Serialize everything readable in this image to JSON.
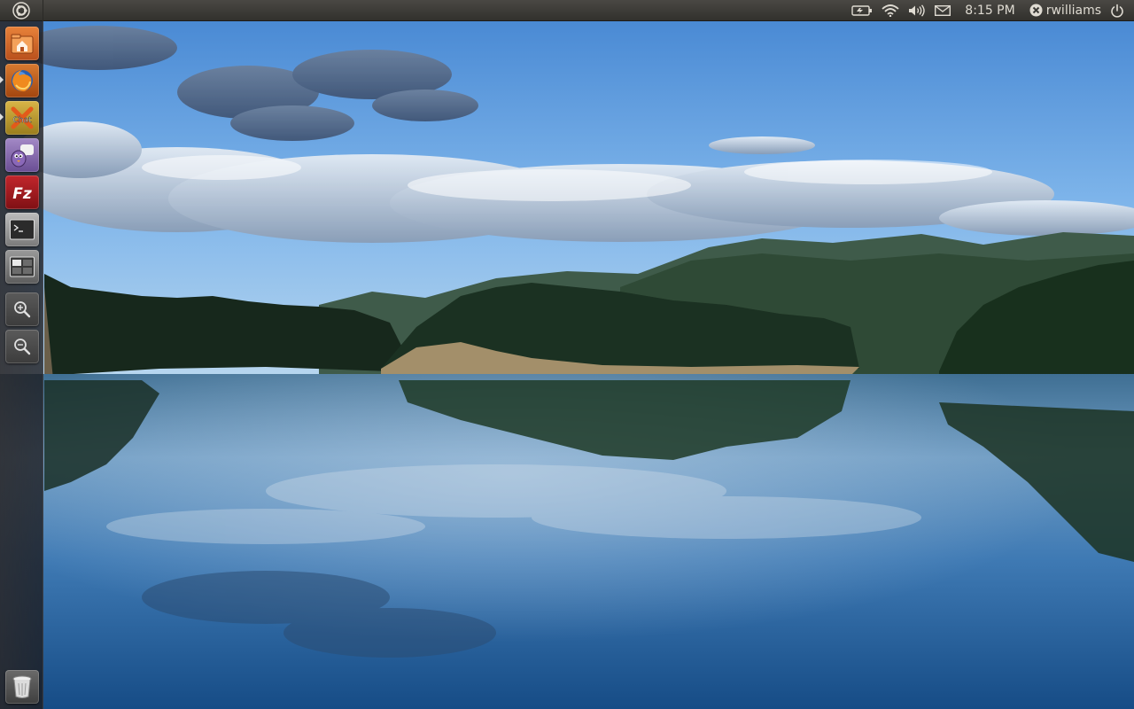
{
  "panel": {
    "clock": "8:15 PM",
    "user": "rwilliams",
    "indicators": [
      "battery-icon",
      "wifi-icon",
      "volume-icon",
      "mail-icon",
      "user-status-icon",
      "power-icon"
    ]
  },
  "launcher": {
    "items": [
      {
        "name": "Home Folder",
        "icon": "home-folder-icon",
        "running": false
      },
      {
        "name": "Firefox Web Browser",
        "icon": "firefox-icon",
        "running": true
      },
      {
        "name": "XChat IRC",
        "icon": "xchat-icon",
        "running": true
      },
      {
        "name": "Pidgin Internet Messenger",
        "icon": "pidgin-icon",
        "running": false
      },
      {
        "name": "FileZilla",
        "icon": "filezilla-icon",
        "running": false
      },
      {
        "name": "Terminal",
        "icon": "terminal-icon",
        "running": false
      },
      {
        "name": "Workspace Switcher",
        "icon": "workspace-switcher-icon",
        "running": false
      },
      {
        "name": "Zoom In",
        "icon": "zoom-in-icon",
        "running": false
      },
      {
        "name": "Zoom Out",
        "icon": "zoom-out-icon",
        "running": false
      },
      {
        "name": "Trash",
        "icon": "trash-icon",
        "running": false
      }
    ]
  },
  "labels": {
    "xchat_icon_text": "Chat",
    "filezilla_icon_text": "Fz"
  },
  "colors": {
    "panel_bg": "#3b3a36",
    "panel_text": "#dfdbd2",
    "sky_top": "#4d8fd6",
    "water": "#1e5fa0"
  }
}
